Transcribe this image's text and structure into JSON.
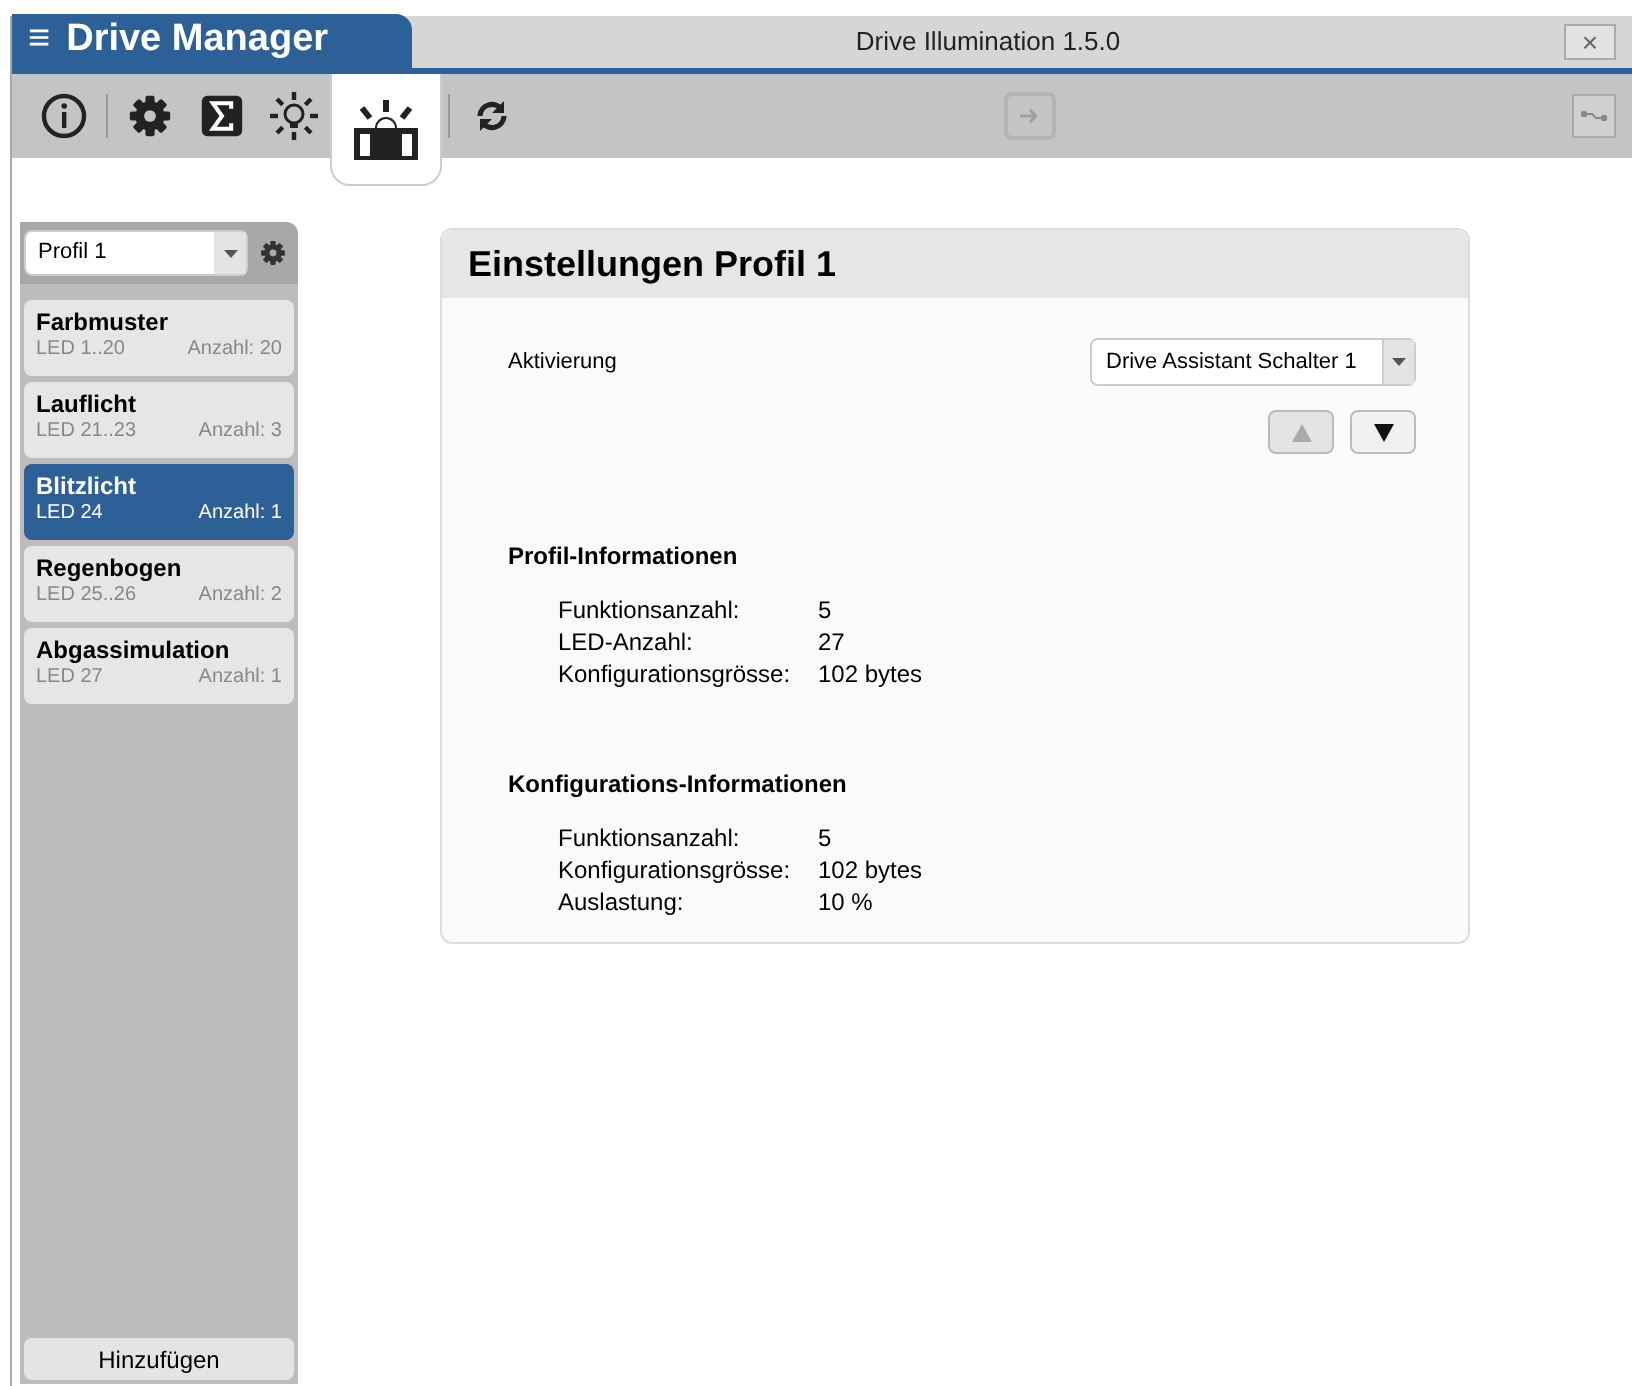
{
  "app_menu": {
    "icon": "≡",
    "title": "Drive Manager"
  },
  "window": {
    "title": "Drive Illumination 1.5.0",
    "close": "×"
  },
  "toolbar": {
    "tools": [
      {
        "kind": "info",
        "selected": false
      },
      {
        "kind": "gear",
        "selected": false
      },
      {
        "kind": "sigma",
        "selected": false
      },
      {
        "kind": "bulb",
        "selected": false
      },
      {
        "kind": "beacon",
        "selected": true
      },
      {
        "kind": "refresh",
        "selected": false
      }
    ],
    "transfer_disabled": true
  },
  "sidebar": {
    "profile_select": {
      "value": "Profil 1"
    },
    "items": [
      {
        "name": "Farbmuster",
        "leds": "LED 1..20",
        "count": "Anzahl: 20",
        "selected": false
      },
      {
        "name": "Lauflicht",
        "leds": "LED 21..23",
        "count": "Anzahl: 3",
        "selected": false
      },
      {
        "name": "Blitzlicht",
        "leds": "LED 24",
        "count": "Anzahl: 1",
        "selected": true
      },
      {
        "name": "Regenbogen",
        "leds": "LED 25..26",
        "count": "Anzahl: 2",
        "selected": false
      },
      {
        "name": "Abgassimulation",
        "leds": "LED 27",
        "count": "Anzahl: 1",
        "selected": false
      }
    ],
    "add_button": "Hinzufügen"
  },
  "panel": {
    "title": "Einstellungen Profil 1",
    "activation": {
      "label": "Aktivierung",
      "value": "Drive Assistant Schalter 1"
    },
    "move_buttons": [
      {
        "kind": "up",
        "disabled": true
      },
      {
        "kind": "down",
        "disabled": false
      }
    ],
    "sections": [
      {
        "title": "Profil-Informationen",
        "rows": [
          {
            "label": "Funktionsanzahl:",
            "value": "5"
          },
          {
            "label": "LED-Anzahl:",
            "value": "27"
          },
          {
            "label": "Konfigurationsgrösse:",
            "value": "102 bytes"
          }
        ]
      },
      {
        "title": "Konfigurations-Informationen",
        "rows": [
          {
            "label": "Funktionsanzahl:",
            "value": "5"
          },
          {
            "label": "Konfigurationsgrösse:",
            "value": "102 bytes"
          },
          {
            "label": "Auslastung:",
            "value": "10 %"
          }
        ]
      }
    ]
  }
}
